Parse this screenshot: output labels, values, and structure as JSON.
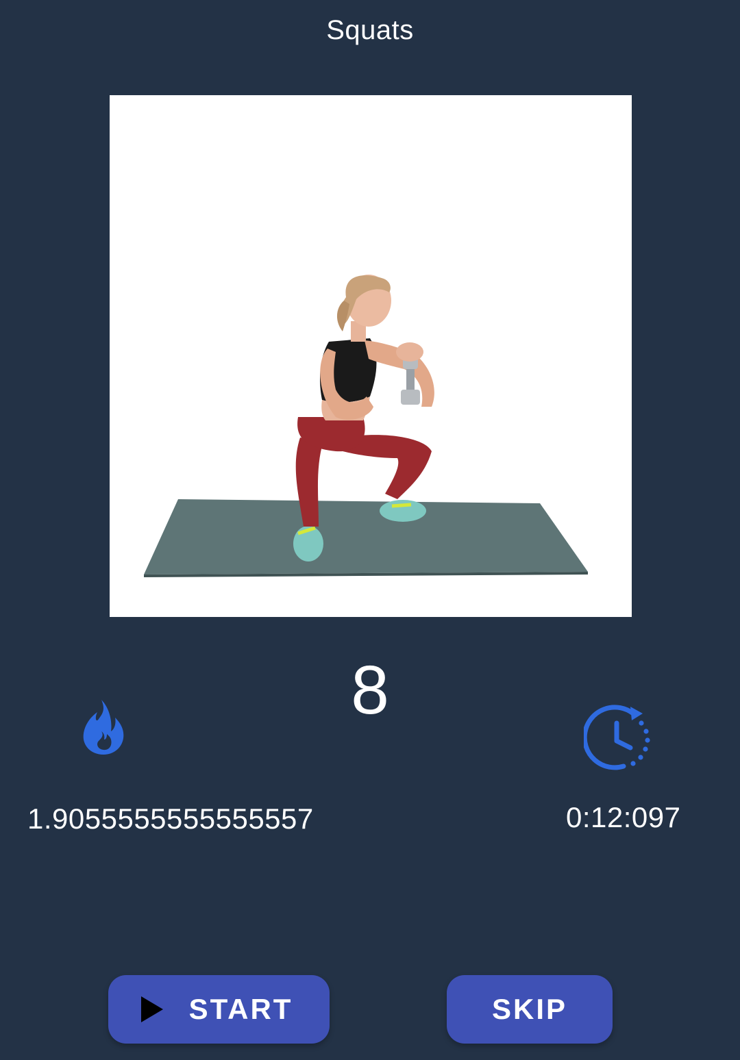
{
  "header": {
    "title": "Squats"
  },
  "exercise": {
    "image_icon": "woman-squat-with-dumbbell-illustration",
    "rep_count": "8"
  },
  "stats": {
    "calories": {
      "icon": "flame-icon",
      "value": "1.9055555555555557"
    },
    "timer": {
      "icon": "timer-icon",
      "value": "0:12:097"
    }
  },
  "buttons": {
    "start_label": "START",
    "start_icon": "play-icon",
    "skip_label": "SKIP"
  },
  "colors": {
    "background": "#233246",
    "accent": "#3f51b5",
    "icon_blue": "#2f6be0"
  }
}
